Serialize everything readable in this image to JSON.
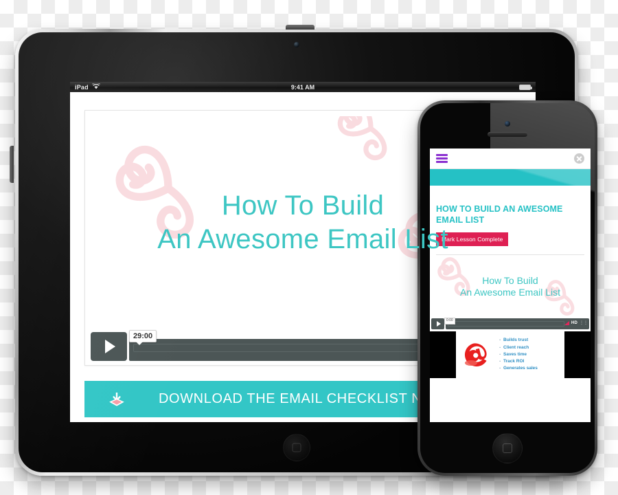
{
  "tablet": {
    "device_name": "iPad",
    "status_bar": {
      "device_label": "iPad",
      "wifi_icon": "wifi-icon",
      "time": "9:41 AM",
      "battery_icon": "battery-icon"
    },
    "slide": {
      "title_line1": "How To Build",
      "title_line2": "An Awesome Email List",
      "watermark_icon": "triskelion-spiral-icon",
      "title_color": "#3dc6c3"
    },
    "player": {
      "play_icon": "play-icon",
      "time_label": "29:00"
    },
    "download_button": {
      "label": "DOWNLOAD THE EMAIL CHECKLIST NOW",
      "icon": "download-tray-icon",
      "bg_color": "#33c6c6"
    },
    "home_button_icon": "home-button-icon",
    "camera_icon": "front-camera-icon",
    "volume_button_icon": "volume-button-icon",
    "power_button_icon": "power-button-icon"
  },
  "phone": {
    "device_name": "iPhone",
    "camera_icon": "front-camera-icon",
    "speaker_icon": "earpiece-speaker-icon",
    "home_button_icon": "home-button-icon",
    "navbar": {
      "menu_icon": "hamburger-menu-icon",
      "menu_icon_color": "#8a2fd0",
      "close_icon": "close-icon"
    },
    "accent_bar_color": "#25c1c5",
    "lesson": {
      "heading": "HOW TO BUILD AN AWESOME EMAIL LIST",
      "heading_color": "#25c1c5",
      "mark_complete_label": "Mark Lesson Complete",
      "mark_complete_color": "#de2053"
    },
    "slide": {
      "title_line1": "How To Build",
      "title_line2": "An Awesome Email List",
      "watermark_icon": "triskelion-spiral-icon"
    },
    "player": {
      "play_icon": "play-icon",
      "time_label": "0:00",
      "hd_label": "HD",
      "volume_icon": "volume-icon",
      "bars_icon": "settings-bars-icon"
    },
    "bottom_slide": {
      "image_icon": "red-at-symbol-icon",
      "bullets": [
        "Builds trust",
        "Client reach",
        "Saves time",
        "Track ROI",
        "Generates sales"
      ],
      "bullet_color": "#2f8fc4"
    }
  }
}
